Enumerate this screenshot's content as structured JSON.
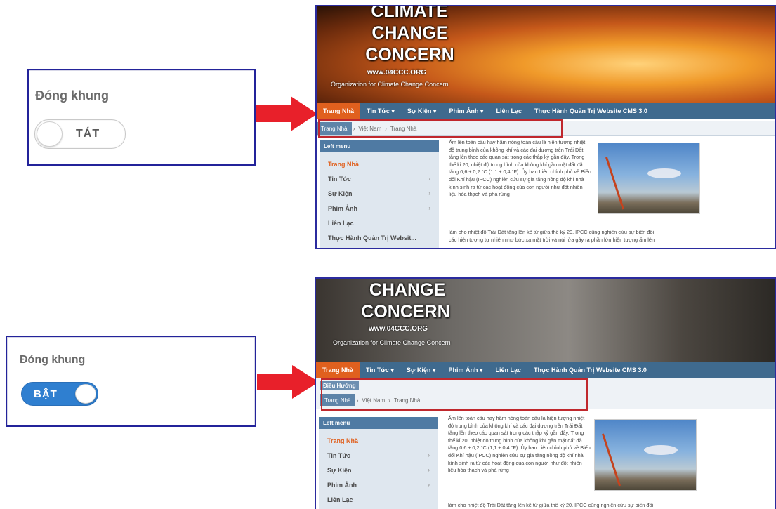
{
  "panels": [
    {
      "toggle_label": "Đóng khung",
      "toggle_state_text": "TẮT",
      "toggle_on": false
    },
    {
      "toggle_label": "Đóng khung",
      "toggle_state_text": "BẬT",
      "toggle_on": true
    }
  ],
  "site": {
    "banner_title_top": "CLIMATE",
    "banner_title_mid": "CHANGE",
    "banner_title_bottom": "CONCERN",
    "banner_url": "www.04CCC.ORG",
    "banner_org": "Organization for Climate Change Concern",
    "nav": [
      "Trang Nhà",
      "Tin Tức ▾",
      "Sự Kiện ▾",
      "Phim Ảnh ▾",
      "Liên Lạc",
      "Thực Hành Quản Trị Website CMS 3.0"
    ],
    "breadcrumb_heading": "Điều Hướng",
    "breadcrumbs": [
      "Trang Nhà",
      "Việt Nam",
      "Trang Nhà"
    ],
    "left_menu_title": "Left menu",
    "left_menu": [
      "Trang Nhà",
      "Tin Tức",
      "Sự Kiện",
      "Phim Ảnh",
      "Liên Lạc",
      "Thực Hành Quản Trị Websit..."
    ],
    "article": "Ấm lên toàn cầu hay hâm nóng toàn cầu là hiện tượng nhiệt độ trung bình của không khí và các đại dương trên Trái Đất tăng lên theo các quan sát trong các thập kỷ gần đây. Trong thế kỉ 20, nhiệt độ trung bình của không khí gần mặt đất đã tăng 0,6 ± 0,2 °C (1,1 ± 0,4 °F). Ủy ban Liên chính phủ về Biến đổi Khí hậu (IPCC) nghiên cứu sự gia tăng nồng độ khí nhà kính sinh ra từ các hoạt động của con người như đốt nhiên liệu hóa thạch và phá rừng",
    "article_tail_1": "làm cho nhiệt độ Trái Đất tăng lên kể từ giữa thế kỷ 20. IPCC cũng nghiên cứu sự biến đổi",
    "article_tail_2": "các hiện tượng tự nhiên như bức xạ mặt trời và núi lửa gây ra phần lớn hiện tượng ấm lên"
  },
  "colors": {
    "frame_blue": "#23239a",
    "highlight_red": "#c0282d",
    "arrow_red": "#e8202a",
    "toggle_on_blue": "#2f7fd0",
    "nav_blue": "#3f6a8e",
    "nav_active_orange": "#e0601e"
  }
}
